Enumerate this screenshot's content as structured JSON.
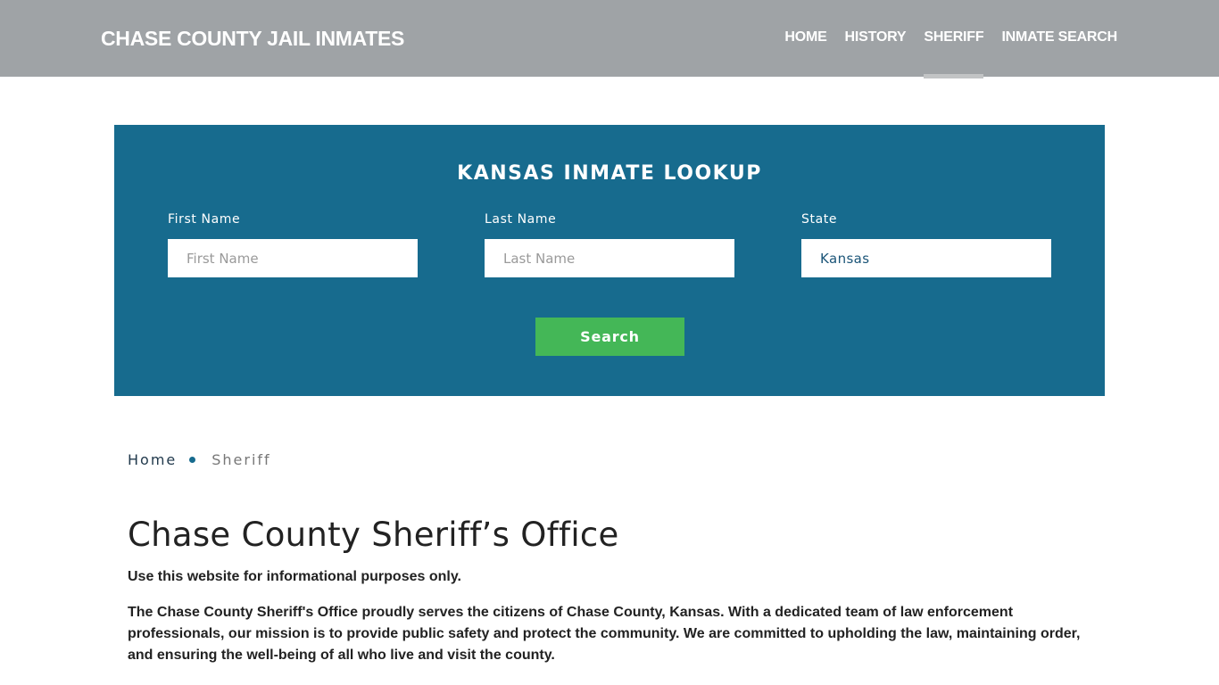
{
  "header": {
    "brand": "CHASE COUNTY JAIL INMATES",
    "nav": [
      {
        "label": "HOME",
        "active": false
      },
      {
        "label": "HISTORY",
        "active": false
      },
      {
        "label": "SHERIFF",
        "active": true
      },
      {
        "label": "INMATE SEARCH",
        "active": false
      }
    ]
  },
  "lookup": {
    "title": "KANSAS INMATE LOOKUP",
    "fields": [
      {
        "label": "First Name",
        "placeholder": "First Name",
        "value": ""
      },
      {
        "label": "Last Name",
        "placeholder": "Last Name",
        "value": ""
      },
      {
        "label": "State",
        "placeholder": "",
        "value": "Kansas"
      }
    ],
    "button_label": "Search"
  },
  "breadcrumb": {
    "items": [
      "Home",
      "Sheriff"
    ]
  },
  "content": {
    "title": "Chase County Sheriff’s Office",
    "disclaimer": "Use this website for informational purposes only.",
    "intro": "The Chase County Sheriff's Office proudly serves the citizens of Chase County, Kansas. With a dedicated team of law enforcement professionals, our mission is to provide public safety and protect the community. We are committed to upholding the law, maintaining order, and ensuring the well-being of all who live and visit the county."
  },
  "colors": {
    "header_bg": "#9fa3a6",
    "lookup_bg": "#176b8e",
    "button_bg": "#44b757",
    "active_indicator": "#c2c4c5"
  }
}
